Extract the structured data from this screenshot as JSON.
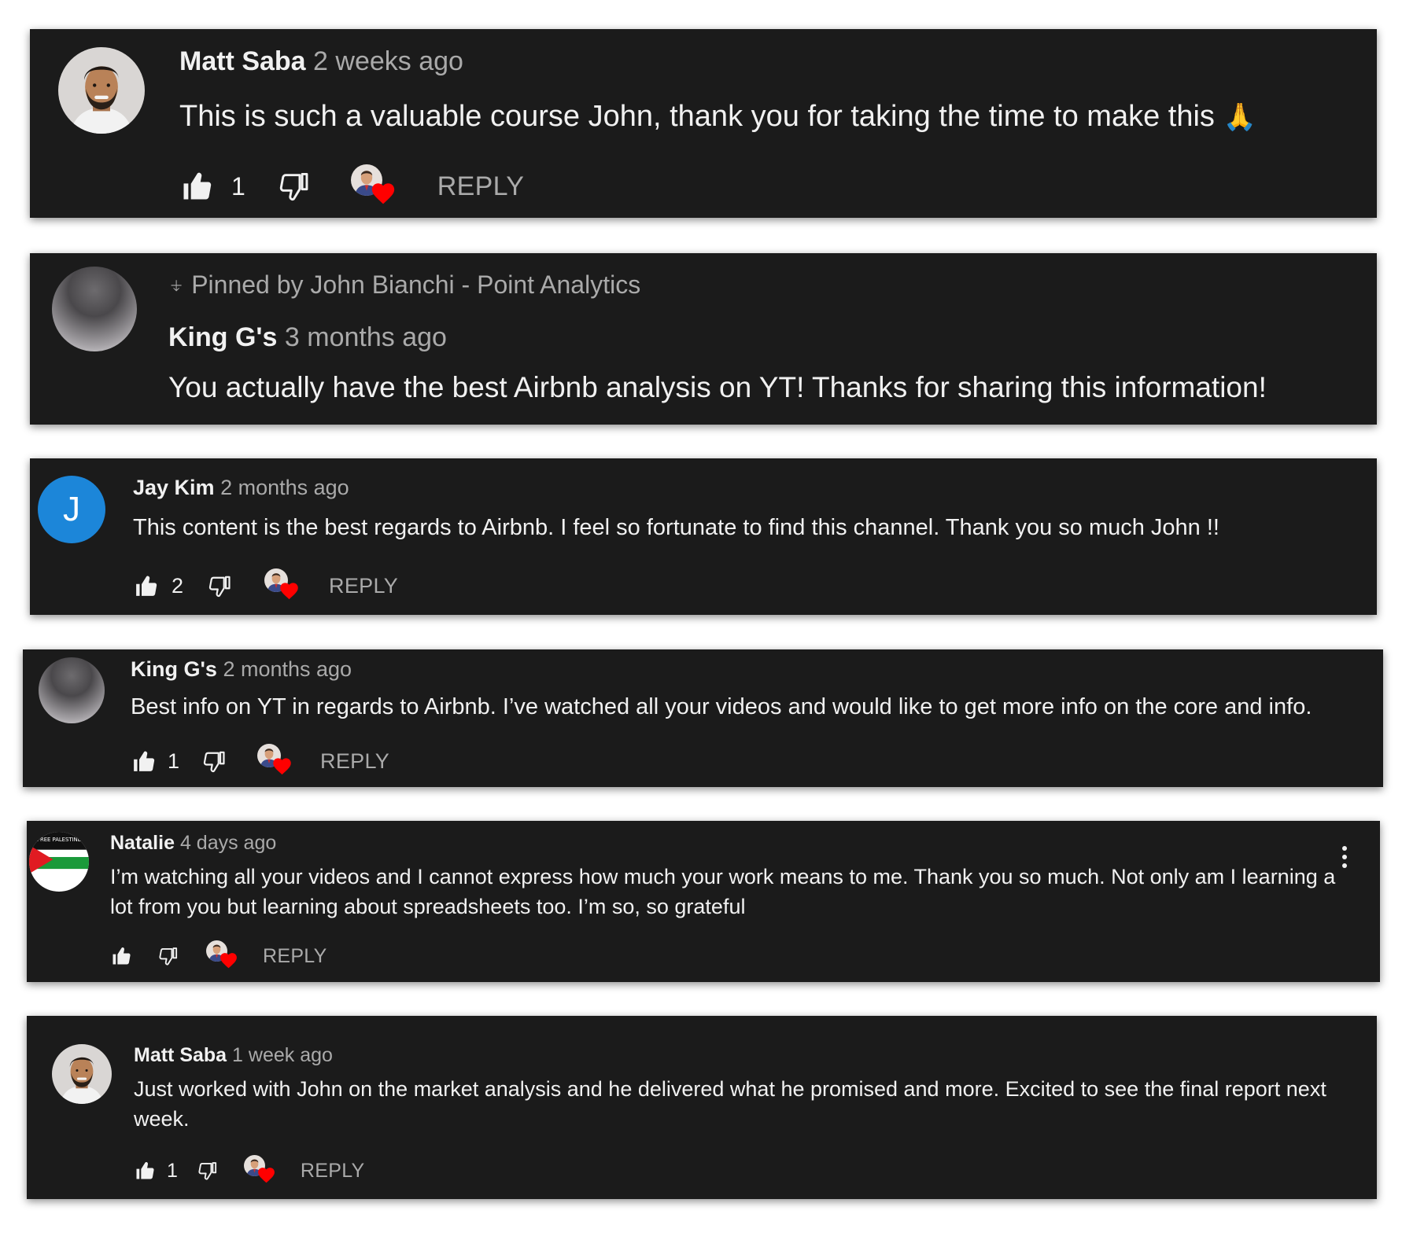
{
  "comments": [
    {
      "author": "Matt Saba",
      "time": "2 weeks ago",
      "text": "This is such a valuable course John, thank you for taking the time to make this",
      "emoji": "🙏",
      "likes": "1",
      "reply_label": "REPLY",
      "avatar_icon": "person-photo-icon"
    },
    {
      "pinned_label": "Pinned by John Bianchi - Point Analytics",
      "author": "King G's",
      "time": "3 months ago",
      "text": "You actually have the best Airbnb analysis on YT! Thanks for sharing this information!",
      "avatar_icon": "gray-avatar-icon"
    },
    {
      "author": "Jay Kim",
      "time": "2 months ago",
      "text": "This content is the best regards to Airbnb. I feel so fortunate to find this channel. Thank you so much John !!",
      "likes": "2",
      "reply_label": "REPLY",
      "avatar_letter": "J",
      "avatar_color": "#1c86d9"
    },
    {
      "author": "King G's",
      "time": "2 months ago",
      "text": "Best info on YT in regards to Airbnb. I’ve watched all your videos and would like to get more info on the core and info.",
      "likes": "1",
      "reply_label": "REPLY",
      "avatar_icon": "gray-avatar-icon"
    },
    {
      "author": "Natalie",
      "time": "4 days ago",
      "text": "I’m watching all your videos and I cannot express how much your work means to me. Thank you so much. Not only am I learning a lot from you but learning about spreadsheets too. I’m so, so grateful",
      "likes": "",
      "reply_label": "REPLY",
      "avatar_icon": "flag-avatar-icon"
    },
    {
      "author": "Matt Saba",
      "time": "1 week ago",
      "text": "Just worked with John on the market analysis and he delivered what he promised and more. Excited to see the final report next week.",
      "likes": "1",
      "reply_label": "REPLY",
      "avatar_icon": "person-photo-icon"
    }
  ],
  "colors": {
    "card_bg": "#1b1b1b",
    "text_primary": "#f1f1f1",
    "text_secondary": "#aaaaaa",
    "heart": "#ff0000",
    "avatar_blue": "#1c86d9"
  }
}
